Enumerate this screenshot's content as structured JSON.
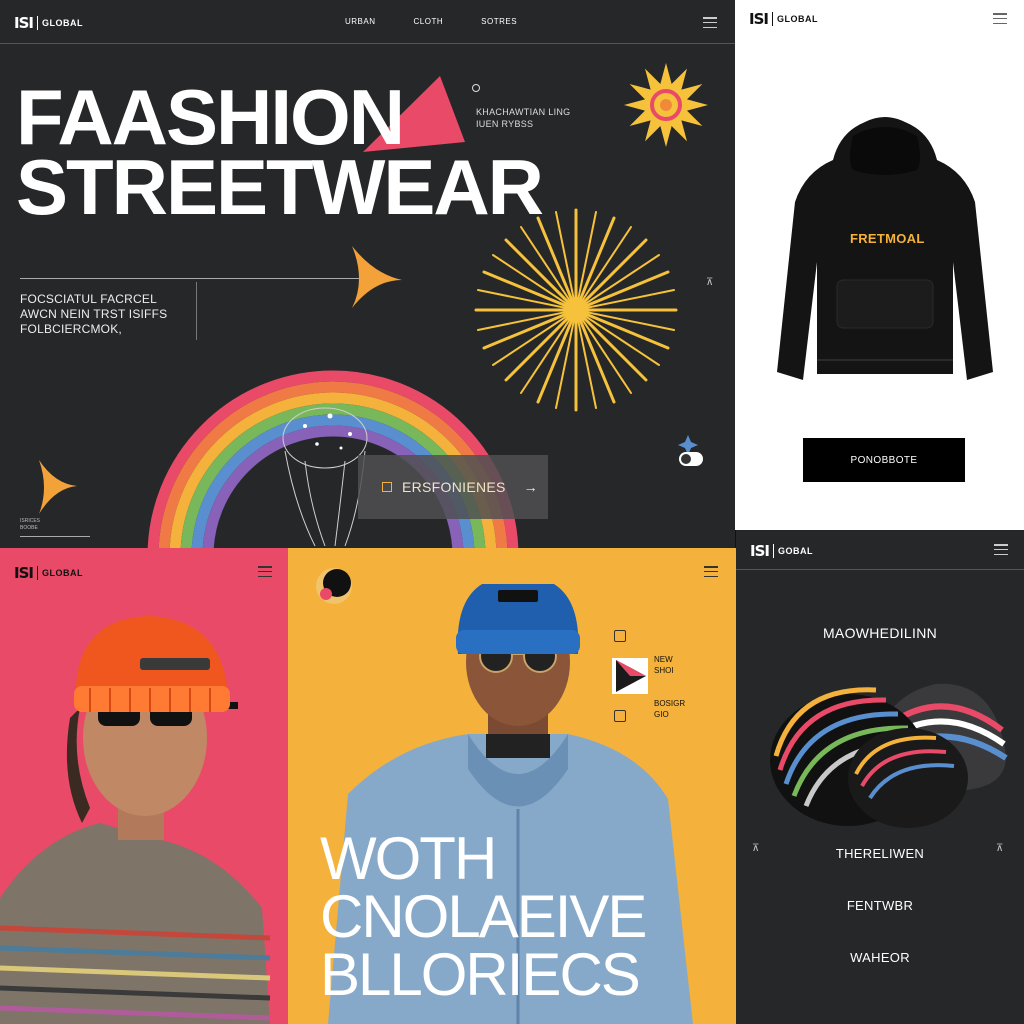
{
  "hero": {
    "logo_mark": "ISI",
    "logo_name": "GLOBAL",
    "nav": [
      "URBAN",
      "CLOTH",
      "SOTRES"
    ],
    "title_line1": "FAASHION",
    "title_line2": "STREETWEAR",
    "side_note_line1": "KHACHAWTIAN LING",
    "side_note_line2": "IUEN RYBSS",
    "intro_line1": "FOCSCIATUL FACRCEL",
    "intro_line2": "AWCN NEIN TRST ISIFFS",
    "intro_line3": "FOLBCIERCMOK,",
    "cta_label": "ERSFONIENES",
    "caption_line1": "ISRICES",
    "caption_line2": "BOOBE"
  },
  "product": {
    "logo_mark": "ISI",
    "logo_name": "GLOBAL",
    "hoodie_print": "FRETMOAL",
    "button_label": "PONOBBOTE"
  },
  "model_left": {
    "logo_mark": "ISI",
    "logo_name": "GLOBAL"
  },
  "model_center": {
    "tag1_line1": "NEW",
    "tag1_line2": "SHOI",
    "tag2_line1": "BOSIGR",
    "tag2_line2": "GIO",
    "headline_line1": "WOTH",
    "headline_line2": "CNOLAEIVE",
    "headline_line3": "BLLORIECS"
  },
  "accessory": {
    "logo_mark": "ISI",
    "logo_name": "GOBAL",
    "heading": "MAOWHEDILINN",
    "menu": [
      "THERELIWEN",
      "FENTWBR",
      "WAHEOR"
    ]
  },
  "colors": {
    "dark": "#262729",
    "pink": "#e94a68",
    "yellow": "#f4b13b",
    "sun": "#f6c23b",
    "white": "#ffffff"
  },
  "icons": [
    "menu-icon",
    "sun-icon",
    "starburst-icon",
    "arrow-icon",
    "rainbow-graphic",
    "hoodie-image",
    "cap-image"
  ]
}
